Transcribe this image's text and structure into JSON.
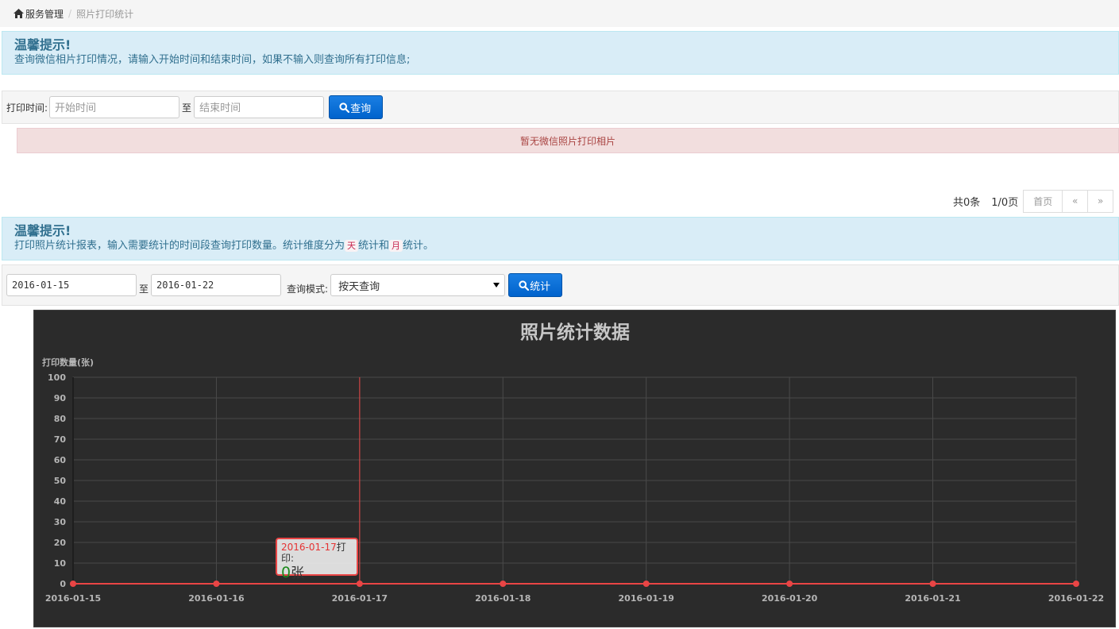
{
  "breadcrumb": {
    "root": "服务管理",
    "current": "照片打印统计"
  },
  "tip1": {
    "title": "温馨提示!",
    "text": "查询微信相片打印情况，请输入开始时间和结束时间，如果不输入则查询所有打印信息;"
  },
  "search": {
    "label": "打印时间:",
    "start_placeholder": "开始时间",
    "to": "至",
    "end_placeholder": "结束时间",
    "button": "查询"
  },
  "empty_notice": "暂无微信照片打印相片",
  "pager": {
    "total": "共0条",
    "page": "1/0页",
    "first": "首页",
    "prev": "«",
    "next": "»"
  },
  "tip2": {
    "title": "温馨提示!",
    "text_a": "打印照片统计报表，输入需要统计的时间段查询打印数量。统计维度分为",
    "code_day": "天",
    "text_b": "统计和",
    "code_month": "月",
    "text_c": "统计。"
  },
  "stat": {
    "start_value": "2016-01-15",
    "to": "至",
    "end_value": "2016-01-22",
    "mode_label": "查询模式:",
    "mode_value": "按天查询",
    "button": "统计"
  },
  "tooltip": {
    "date": "2016-01-17",
    "label": "打印:",
    "value": "0",
    "unit": "张"
  },
  "colors": {
    "accent": "#0a6fd6",
    "series": "#e94545",
    "chart_bg": "#2b2b2b"
  },
  "chart_data": {
    "type": "line",
    "title": "照片统计数据",
    "ylabel": "打印数量(张)",
    "xlabel": "",
    "categories": [
      "2016-01-15",
      "2016-01-16",
      "2016-01-17",
      "2016-01-18",
      "2016-01-19",
      "2016-01-20",
      "2016-01-21",
      "2016-01-22"
    ],
    "series": [
      {
        "values": [
          0,
          0,
          0,
          0,
          0,
          0,
          0,
          0
        ]
      }
    ],
    "yticks": [
      0,
      10,
      20,
      30,
      40,
      50,
      60,
      70,
      80,
      90,
      100
    ],
    "ylim": [
      0,
      100
    ],
    "grid": true,
    "highlight_index": 2
  }
}
